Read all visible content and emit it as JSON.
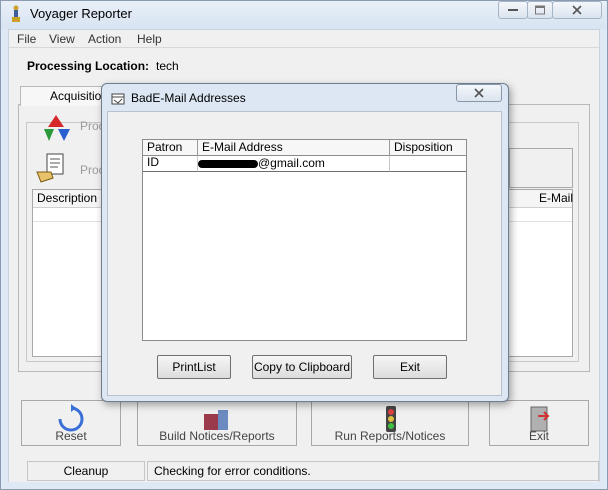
{
  "window": {
    "title": "Voyager Reporter"
  },
  "menu": [
    "File",
    "View",
    "Action",
    "Help"
  ],
  "location": {
    "label": "Processing Location:",
    "value": "tech"
  },
  "tabs": {
    "acquisitions": "Acquisition"
  },
  "background": {
    "proc1": "Proc",
    "proc2": "Proc",
    "list_headers": {
      "description": "Description",
      "email": "E-Mail"
    }
  },
  "buttons": {
    "reset": "Reset",
    "build": "Build Notices/Reports",
    "run": "Run Reports/Notices",
    "exit": "Exit"
  },
  "status": {
    "left": "Cleanup",
    "right": "Checking for error conditions."
  },
  "dialog": {
    "title": "BadE-Mail Addresses",
    "columns": {
      "patron_id": "Patron ID",
      "email": "E-Mail Address",
      "disposition": "Disposition"
    },
    "rows": [
      {
        "patron_id": "",
        "email": "@gmail.com",
        "disposition": ""
      }
    ],
    "buttons": {
      "print": "PrintList",
      "copy": "Copy to Clipboard",
      "exit": "Exit"
    }
  }
}
